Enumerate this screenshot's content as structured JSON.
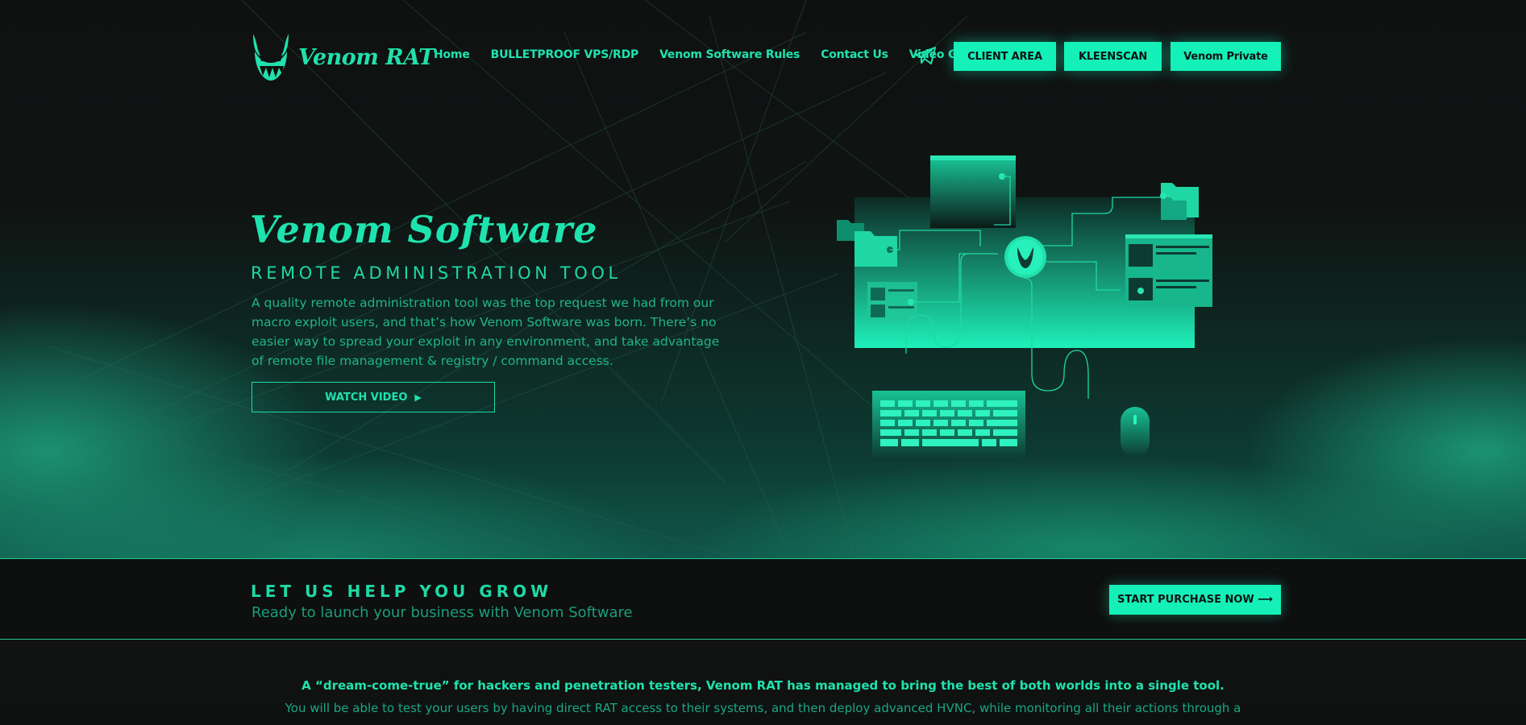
{
  "brand": {
    "name": "Venom RAT"
  },
  "nav": {
    "items": [
      {
        "label": "Home"
      },
      {
        "label": "BULLETPROOF VPS/RDP"
      },
      {
        "label": "Venom Software Rules"
      },
      {
        "label": "Contact Us"
      },
      {
        "label": "Video Gallery"
      }
    ],
    "telegram_icon": "telegram-icon"
  },
  "header_buttons": {
    "client_area": "CLIENT AREA",
    "kleenscan": "KLEENSCAN",
    "venom_private": "Venom Private"
  },
  "hero": {
    "title": "Venom Software",
    "subtitle": "REMOTE ADMINISTRATION TOOL",
    "description": "A quality remote administration tool was the top request we had from our macro exploit users, and that’s how Venom Software was born. There’s no easier way to spread your exploit in any environment, and take advantage of remote file management & registry / command access.",
    "watch_label": "WATCH VIDEO",
    "watch_icon": "play-icon"
  },
  "cta": {
    "title": "LET US HELP YOU GROW",
    "subtitle": "Ready to launch your business with Venom Software",
    "button": "START PURCHASE NOW ⟶"
  },
  "intro": {
    "headline": "A “dream-come-true” for hackers and penetration testers, Venom RAT has managed to bring the best of both worlds into a single tool.",
    "text": "You will be able to test your users by having direct RAT access to their systems, and then deploy advanced HVNC, while monitoring all their actions through a"
  },
  "colors": {
    "accent": "#14f0b8",
    "text_green": "#1fd9a5",
    "background": "#0e0f0f"
  }
}
